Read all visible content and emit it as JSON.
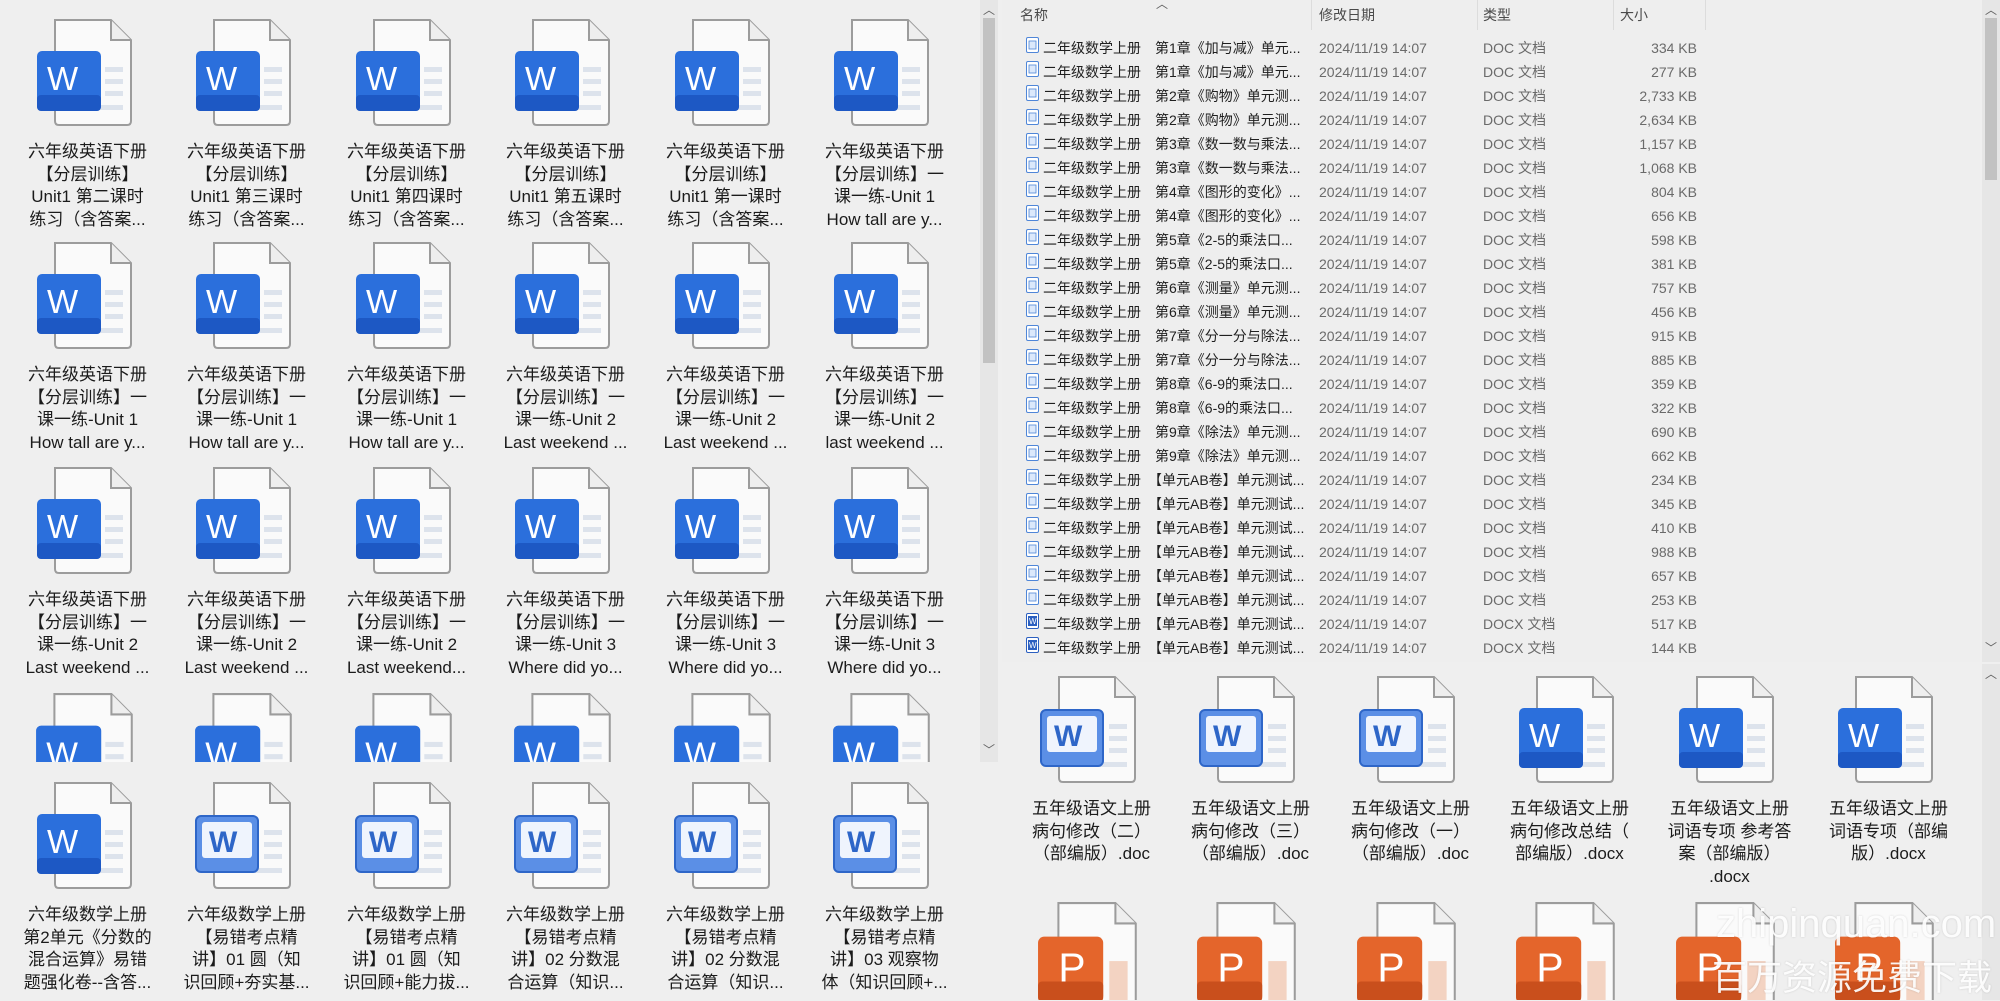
{
  "colors": {
    "word_blue": "#2b6fdc",
    "ppt_orange": "#e4652b",
    "panel_bg": "#efefef"
  },
  "left_top": {
    "rows": [
      [
        {
          "icon": "word",
          "label": "六年级英语下册\n【分层训练】\nUnit1 第二课时\n练习（含答案..."
        },
        {
          "icon": "word",
          "label": "六年级英语下册\n【分层训练】\nUnit1 第三课时\n练习（含答案..."
        },
        {
          "icon": "word",
          "label": "六年级英语下册\n【分层训练】\nUnit1 第四课时\n练习（含答案..."
        },
        {
          "icon": "word",
          "label": "六年级英语下册\n【分层训练】\nUnit1 第五课时\n练习（含答案..."
        },
        {
          "icon": "word",
          "label": "六年级英语下册\n【分层训练】\nUnit1 第一课时\n练习（含答案..."
        },
        {
          "icon": "word",
          "label": "六年级英语下册\n【分层训练】一\n课一练-Unit 1\nHow tall are y..."
        }
      ],
      [
        {
          "icon": "word",
          "label": "六年级英语下册\n【分层训练】一\n课一练-Unit 1\nHow tall are y..."
        },
        {
          "icon": "word",
          "label": "六年级英语下册\n【分层训练】一\n课一练-Unit 1\nHow tall are y..."
        },
        {
          "icon": "word",
          "label": "六年级英语下册\n【分层训练】一\n课一练-Unit 1\nHow tall are y..."
        },
        {
          "icon": "word",
          "label": "六年级英语下册\n【分层训练】一\n课一练-Unit 2\nLast weekend ..."
        },
        {
          "icon": "word",
          "label": "六年级英语下册\n【分层训练】一\n课一练-Unit 2\nLast weekend ..."
        },
        {
          "icon": "word",
          "label": "六年级英语下册\n【分层训练】一\n课一练-Unit 2\nlast weekend ..."
        }
      ],
      [
        {
          "icon": "word",
          "label": "六年级英语下册\n【分层训练】一\n课一练-Unit 2\nLast weekend ..."
        },
        {
          "icon": "word",
          "label": "六年级英语下册\n【分层训练】一\n课一练-Unit 2\nLast weekend ..."
        },
        {
          "icon": "word",
          "label": "六年级英语下册\n【分层训练】一\n课一练-Unit 2\nLast weekend..."
        },
        {
          "icon": "word",
          "label": "六年级英语下册\n【分层训练】一\n课一练-Unit 3\nWhere did yo..."
        },
        {
          "icon": "word",
          "label": "六年级英语下册\n【分层训练】一\n课一练-Unit 3\nWhere did yo..."
        },
        {
          "icon": "word",
          "label": "六年级英语下册\n【分层训练】一\n课一练-Unit 3\nWhere did yo..."
        }
      ]
    ],
    "partial_row_icons": [
      "word",
      "word",
      "word",
      "word",
      "word",
      "word"
    ]
  },
  "left_bottom": {
    "items": [
      {
        "icon": "word",
        "label": "六年级数学上册\n第2单元《分数的\n混合运算》易错\n题强化卷--含答..."
      },
      {
        "icon": "word-legacy",
        "label": "六年级数学上册\n【易错考点精\n讲】01 圆（知\n识回顾+夯实基..."
      },
      {
        "icon": "word-legacy",
        "label": "六年级数学上册\n【易错考点精\n讲】01 圆（知\n识回顾+能力拔..."
      },
      {
        "icon": "word-legacy",
        "label": "六年级数学上册\n【易错考点精\n讲】02 分数混\n合运算（知识..."
      },
      {
        "icon": "word-legacy",
        "label": "六年级数学上册\n【易错考点精\n讲】02 分数混\n合运算（知识..."
      },
      {
        "icon": "word-legacy",
        "label": "六年级数学上册\n【易错考点精\n讲】03 观察物\n体（知识回顾+..."
      }
    ]
  },
  "details": {
    "columns": {
      "name": "名称",
      "date": "修改日期",
      "type": "类型",
      "size": "大小"
    },
    "rows": [
      {
        "icon": "doc",
        "name": "二年级数学上册　第1章《加与减》单元...",
        "date": "2024/11/19 14:07",
        "type": "DOC 文档",
        "size": "334 KB"
      },
      {
        "icon": "doc",
        "name": "二年级数学上册　第1章《加与减》单元...",
        "date": "2024/11/19 14:07",
        "type": "DOC 文档",
        "size": "277 KB"
      },
      {
        "icon": "doc",
        "name": "二年级数学上册　第2章《购物》单元测...",
        "date": "2024/11/19 14:07",
        "type": "DOC 文档",
        "size": "2,733 KB"
      },
      {
        "icon": "doc",
        "name": "二年级数学上册　第2章《购物》单元测...",
        "date": "2024/11/19 14:07",
        "type": "DOC 文档",
        "size": "2,634 KB"
      },
      {
        "icon": "doc",
        "name": "二年级数学上册　第3章《数一数与乘法...",
        "date": "2024/11/19 14:07",
        "type": "DOC 文档",
        "size": "1,157 KB"
      },
      {
        "icon": "doc",
        "name": "二年级数学上册　第3章《数一数与乘法...",
        "date": "2024/11/19 14:07",
        "type": "DOC 文档",
        "size": "1,068 KB"
      },
      {
        "icon": "doc",
        "name": "二年级数学上册　第4章《图形的变化》...",
        "date": "2024/11/19 14:07",
        "type": "DOC 文档",
        "size": "804 KB"
      },
      {
        "icon": "doc",
        "name": "二年级数学上册　第4章《图形的变化》...",
        "date": "2024/11/19 14:07",
        "type": "DOC 文档",
        "size": "656 KB"
      },
      {
        "icon": "doc",
        "name": "二年级数学上册　第5章《2-5的乘法口...",
        "date": "2024/11/19 14:07",
        "type": "DOC 文档",
        "size": "598 KB"
      },
      {
        "icon": "doc",
        "name": "二年级数学上册　第5章《2-5的乘法口...",
        "date": "2024/11/19 14:07",
        "type": "DOC 文档",
        "size": "381 KB"
      },
      {
        "icon": "doc",
        "name": "二年级数学上册　第6章《测量》单元测...",
        "date": "2024/11/19 14:07",
        "type": "DOC 文档",
        "size": "757 KB"
      },
      {
        "icon": "doc",
        "name": "二年级数学上册　第6章《测量》单元测...",
        "date": "2024/11/19 14:07",
        "type": "DOC 文档",
        "size": "456 KB"
      },
      {
        "icon": "doc",
        "name": "二年级数学上册　第7章《分一分与除法...",
        "date": "2024/11/19 14:07",
        "type": "DOC 文档",
        "size": "915 KB"
      },
      {
        "icon": "doc",
        "name": "二年级数学上册　第7章《分一分与除法...",
        "date": "2024/11/19 14:07",
        "type": "DOC 文档",
        "size": "885 KB"
      },
      {
        "icon": "doc",
        "name": "二年级数学上册　第8章《6-9的乘法口...",
        "date": "2024/11/19 14:07",
        "type": "DOC 文档",
        "size": "359 KB"
      },
      {
        "icon": "doc",
        "name": "二年级数学上册　第8章《6-9的乘法口...",
        "date": "2024/11/19 14:07",
        "type": "DOC 文档",
        "size": "322 KB"
      },
      {
        "icon": "doc",
        "name": "二年级数学上册　第9章《除法》单元测...",
        "date": "2024/11/19 14:07",
        "type": "DOC 文档",
        "size": "690 KB"
      },
      {
        "icon": "doc",
        "name": "二年级数学上册　第9章《除法》单元测...",
        "date": "2024/11/19 14:07",
        "type": "DOC 文档",
        "size": "662 KB"
      },
      {
        "icon": "doc",
        "name": "二年级数学上册　【单元AB卷】单元测试...",
        "date": "2024/11/19 14:07",
        "type": "DOC 文档",
        "size": "234 KB"
      },
      {
        "icon": "doc",
        "name": "二年级数学上册　【单元AB卷】单元测试...",
        "date": "2024/11/19 14:07",
        "type": "DOC 文档",
        "size": "345 KB"
      },
      {
        "icon": "doc",
        "name": "二年级数学上册　【单元AB卷】单元测试...",
        "date": "2024/11/19 14:07",
        "type": "DOC 文档",
        "size": "410 KB"
      },
      {
        "icon": "doc",
        "name": "二年级数学上册　【单元AB卷】单元测试...",
        "date": "2024/11/19 14:07",
        "type": "DOC 文档",
        "size": "988 KB"
      },
      {
        "icon": "doc",
        "name": "二年级数学上册　【单元AB卷】单元测试...",
        "date": "2024/11/19 14:07",
        "type": "DOC 文档",
        "size": "657 KB"
      },
      {
        "icon": "doc",
        "name": "二年级数学上册　【单元AB卷】单元测试...",
        "date": "2024/11/19 14:07",
        "type": "DOC 文档",
        "size": "253 KB"
      },
      {
        "icon": "docx",
        "name": "二年级数学上册　【单元AB卷】单元测试...",
        "date": "2024/11/19 14:07",
        "type": "DOCX 文档",
        "size": "517 KB"
      },
      {
        "icon": "docx",
        "name": "二年级数学上册　【单元AB卷】单元测试...",
        "date": "2024/11/19 14:07",
        "type": "DOCX 文档",
        "size": "144 KB"
      }
    ]
  },
  "right_grid": {
    "items": [
      {
        "icon": "word-legacy",
        "label": "五年级语文上册\n病句修改（二）\n（部编版）.doc"
      },
      {
        "icon": "word-legacy",
        "label": "五年级语文上册\n病句修改（三）\n（部编版）.doc"
      },
      {
        "icon": "word-legacy",
        "label": "五年级语文上册\n病句修改（一）\n（部编版）.doc"
      },
      {
        "icon": "word",
        "label": "五年级语文上册\n病句修改总结（\n部编版）.docx"
      },
      {
        "icon": "word",
        "label": "五年级语文上册\n词语专项 参考答\n案（部编版）\n.docx"
      },
      {
        "icon": "word",
        "label": "五年级语文上册\n词语专项（部编\n版）.docx"
      }
    ],
    "partial_row_icons": [
      "ppt",
      "ppt",
      "ppt",
      "ppt",
      "ppt",
      "ppt"
    ]
  },
  "watermark": {
    "line1": "zhipinquan.com",
    "line2": "百万资源免费下载"
  }
}
